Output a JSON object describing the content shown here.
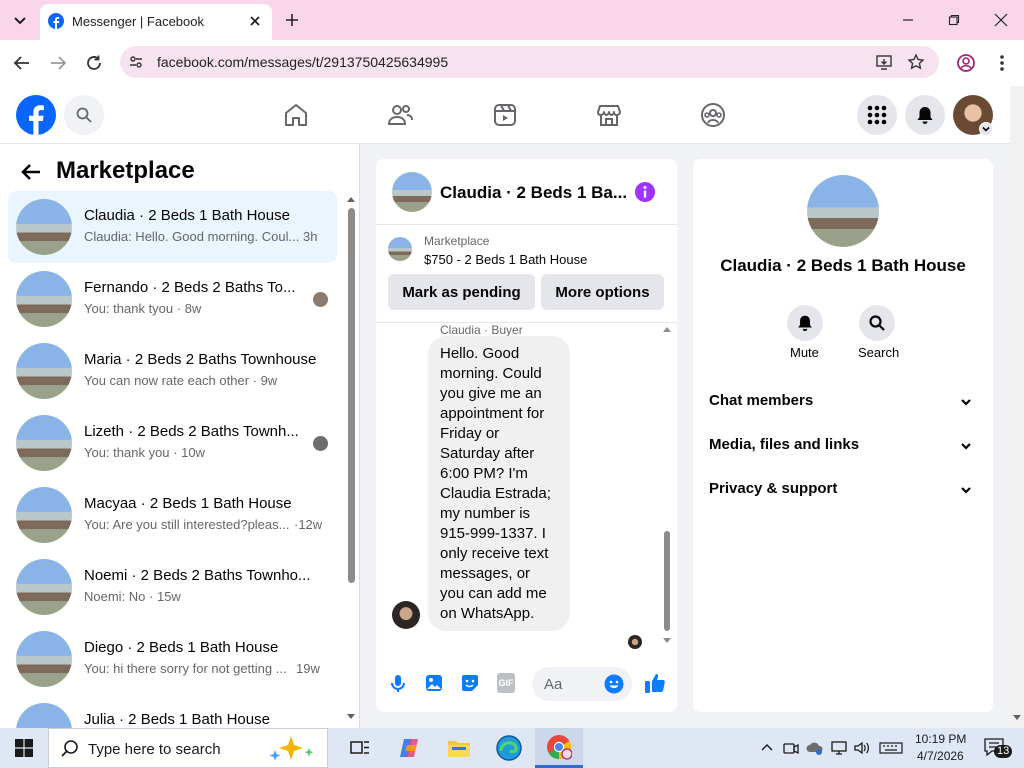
{
  "browser": {
    "tab_title": "Messenger | Facebook",
    "url": "facebook.com/messages/t/2913750425634995"
  },
  "sidebar": {
    "title": "Marketplace",
    "conversations": [
      {
        "name": "Claudia · 2 Beds 1 Bath House",
        "preview": "Claudia: Hello. Good morning. Coul...",
        "time": "3h"
      },
      {
        "name": "Fernando · 2 Beds 2 Baths To...",
        "preview": "You: thank tyou · 8w",
        "time": ""
      },
      {
        "name": "Maria · 2 Beds 2 Baths Townhouse",
        "preview": "You can now rate each other · 9w",
        "time": ""
      },
      {
        "name": "Lizeth · 2 Beds 2 Baths Townh...",
        "preview": "You: thank you · 10w",
        "time": ""
      },
      {
        "name": "Macyaa · 2 Beds 1 Bath House",
        "preview": "You: Are you still interested?pleas...",
        "time": "·12w"
      },
      {
        "name": "Noemi · 2 Beds 2 Baths Townho...",
        "preview": "Noemi: No · 15w",
        "time": ""
      },
      {
        "name": "Diego · 2 Beds 1 Bath House",
        "preview": "You: hi there sorry for not getting ...",
        "time": "19w"
      },
      {
        "name": "Julia · 2 Beds 1 Bath House",
        "preview": "",
        "time": ""
      }
    ]
  },
  "chat": {
    "title": "Claudia · 2 Beds 1 Ba...",
    "listing_label": "Marketplace",
    "listing_text": "$750 - 2 Beds 1 Bath House",
    "mark_pending": "Mark as pending",
    "more_options": "More options",
    "sender_label": "Claudia · Buyer",
    "message": "Hello. Good morning. Could you give me an appointment for Friday or Saturday after 6:00 PM? I'm Claudia Estrada; my number is 915-999-1337. I only receive text messages, or you can add me on WhatsApp.",
    "input_placeholder": "Aa",
    "gif_label": "GIF"
  },
  "info": {
    "title": "Claudia · 2 Beds 1 Bath House",
    "mute_label": "Mute",
    "search_label": "Search",
    "sections": [
      "Chat members",
      "Media, files and links",
      "Privacy & support"
    ]
  },
  "taskbar": {
    "search_placeholder": "Type here to search",
    "time": "10:19 PM",
    "date": "4/7/2026",
    "notif_count": "13"
  },
  "colors": {
    "brand": "#0866ff",
    "messenger_accent": "#0a7cff",
    "info_icon": "#a033ff",
    "selected_row": "#ebf5ff"
  }
}
